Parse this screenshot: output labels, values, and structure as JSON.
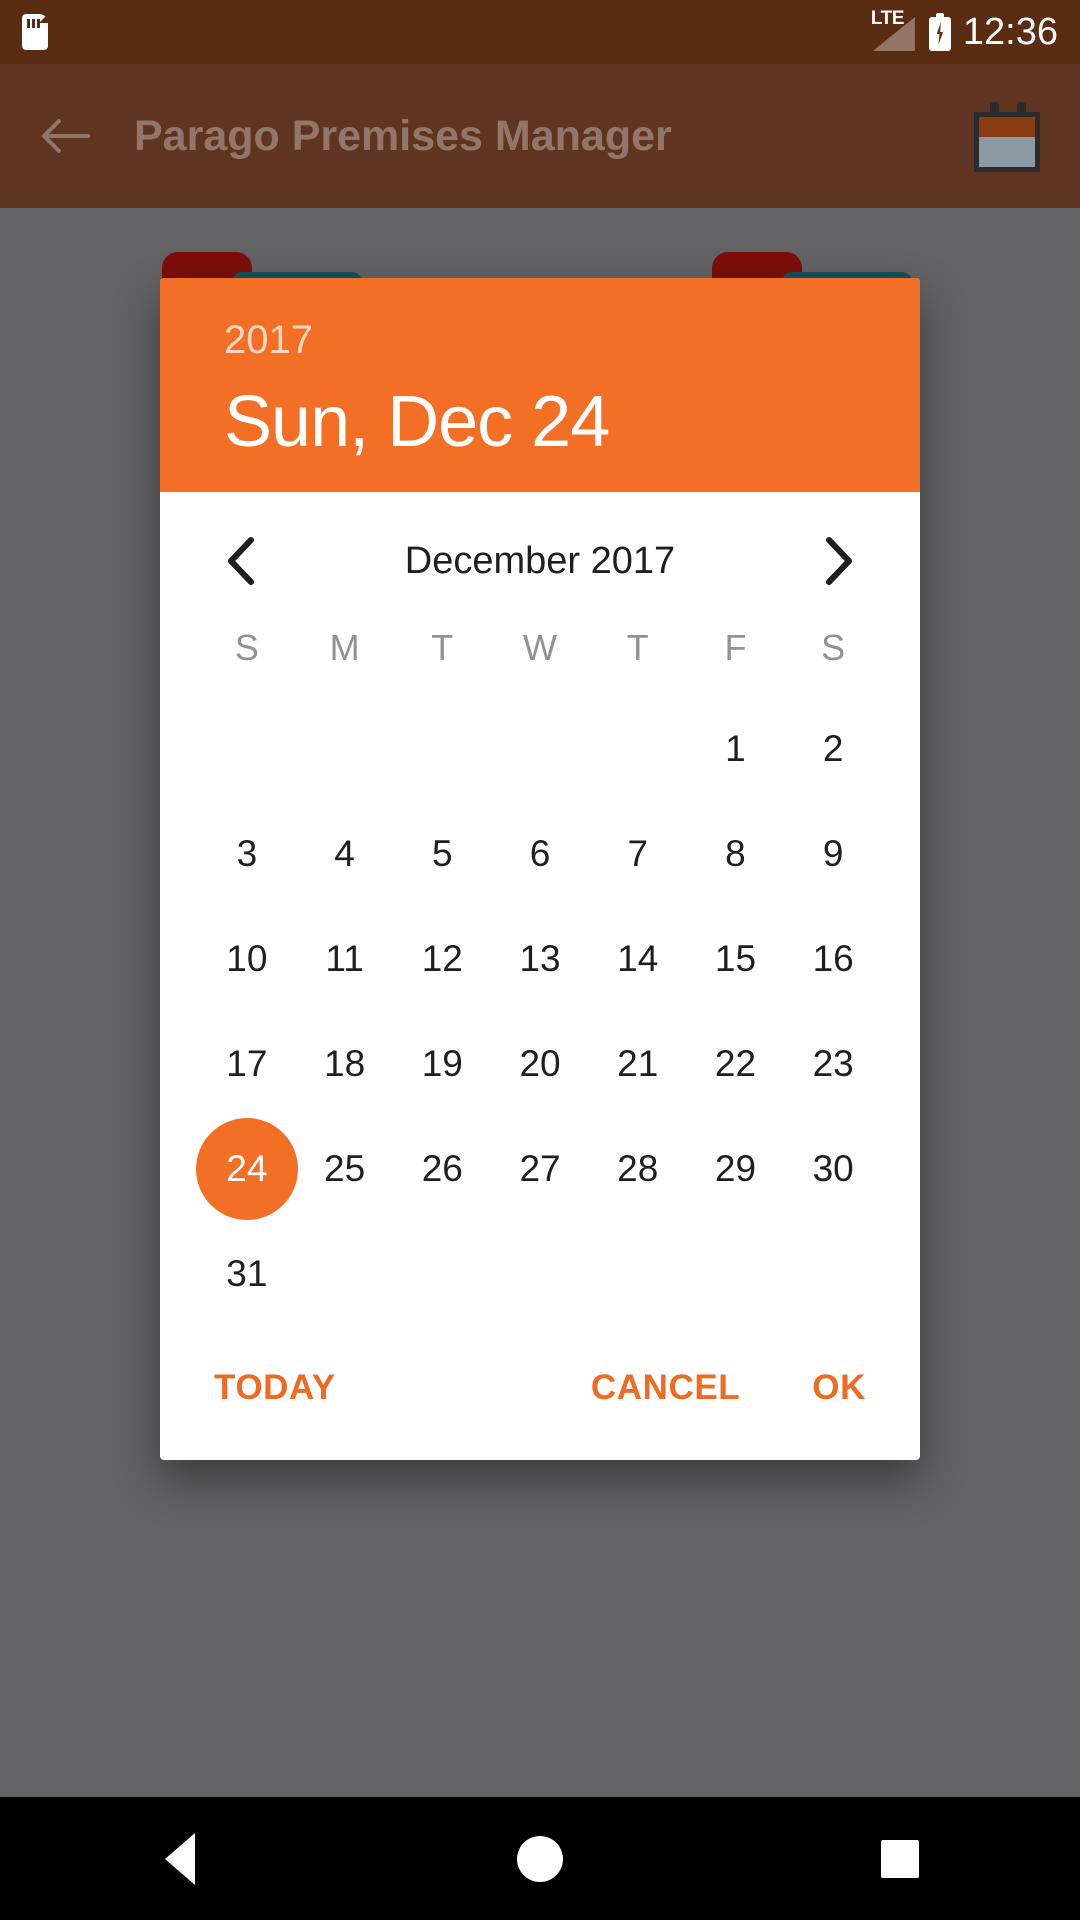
{
  "status_bar": {
    "sd_icon": "sd-card-icon",
    "network_label": "LTE",
    "signal_icon": "signal-bars-icon",
    "battery_icon": "battery-charging-icon",
    "time": "12:36",
    "background_color": "#5a2c12"
  },
  "app_bar": {
    "back_icon": "back-arrow-icon",
    "title": "Parago Premises Manager",
    "action_icon": "calendar-icon",
    "background_color": "#5f3420",
    "title_color": "#8b6f5e"
  },
  "dialog": {
    "header": {
      "year": "2017",
      "selected_date_label": "Sun, Dec 24",
      "background_color": "#f36f25"
    },
    "month_nav": {
      "prev_icon": "chevron-left-icon",
      "next_icon": "chevron-right-icon",
      "month_label": "December 2017"
    },
    "weekdays": [
      "S",
      "M",
      "T",
      "W",
      "T",
      "F",
      "S"
    ],
    "weeks": [
      [
        "",
        "",
        "",
        "",
        "",
        "1",
        "2"
      ],
      [
        "3",
        "4",
        "5",
        "6",
        "7",
        "8",
        "9"
      ],
      [
        "10",
        "11",
        "12",
        "13",
        "14",
        "15",
        "16"
      ],
      [
        "17",
        "18",
        "19",
        "20",
        "21",
        "22",
        "23"
      ],
      [
        "24",
        "25",
        "26",
        "27",
        "28",
        "29",
        "30"
      ],
      [
        "31",
        "",
        "",
        "",
        "",
        "",
        ""
      ]
    ],
    "selected_day": "24",
    "accent_color": "#f36f25",
    "actions": {
      "today": "TODAY",
      "cancel": "CANCEL",
      "ok": "OK"
    }
  },
  "scrim": {
    "color": "#636264"
  },
  "background_cards": [
    {
      "name": "red-card-left",
      "color": "#7c0f09"
    },
    {
      "name": "teal-card-left",
      "color": "#14535d"
    },
    {
      "name": "red-card-right",
      "color": "#7c0f09"
    },
    {
      "name": "teal-card-right",
      "color": "#14535d"
    }
  ],
  "nav_bar": {
    "back_icon": "nav-back-icon",
    "home_icon": "nav-home-icon",
    "recents_icon": "nav-recents-icon",
    "background_color": "#000000"
  }
}
